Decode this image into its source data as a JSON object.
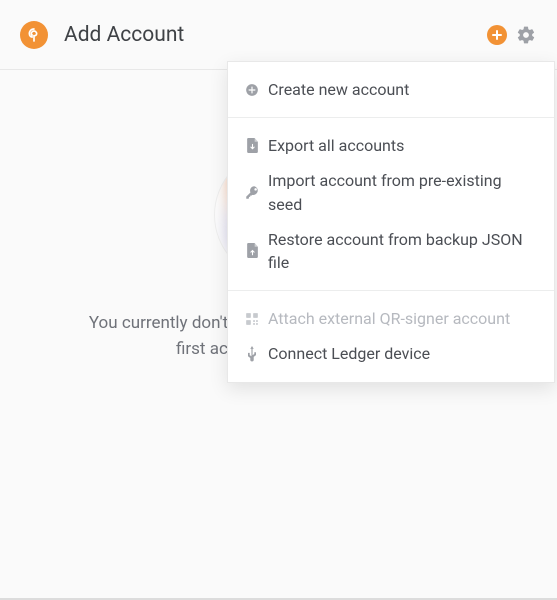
{
  "header": {
    "title": "Add Account"
  },
  "dropdown": {
    "create": "Create new account",
    "export": "Export all accounts",
    "import": "Import account from pre-existing seed",
    "restore": "Restore account from backup JSON file",
    "qr": "Attach external QR-signer account",
    "ledger": "Connect Ledger device"
  },
  "main": {
    "empty": "You currently don't have any accounts. Create your first account to get started."
  },
  "colors": {
    "accent": "#f29235"
  }
}
